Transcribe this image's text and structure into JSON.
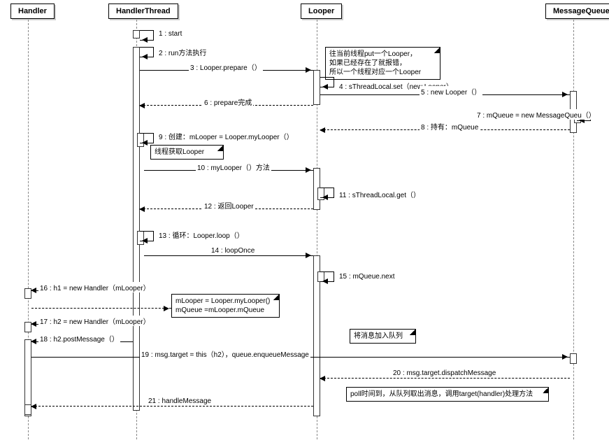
{
  "participants": {
    "handler": "Handler",
    "handlerThread": "HandlerThread",
    "looper": "Looper",
    "messageQueue": "MessageQueue"
  },
  "messages": {
    "m1": "1 : start",
    "m2": "2 : run方法执行",
    "m3": "3 : Looper.prepare（）",
    "m4": "4 : sThreadLocal.set（new Looper）",
    "m5": "5 : new Looper（）",
    "m6": "6 : prepare完成",
    "m7": "7 : mQueue = new MessageQueu（）",
    "m8": "8 : 持有：mQueue",
    "m9": "9 : 创建：mLooper = Looper.myLooper（）",
    "m10": "10 : myLooper（）方法",
    "m11": "11 : sThreadLocal.get（）",
    "m12": "12 : 返回Looper",
    "m13": "13 : 循环：Looper.loop（）",
    "m14": "14 : loopOnce",
    "m15": "15 : mQueue.next",
    "m16": "16 : h1 = new Handler（mLooper）",
    "m17": "17 : h2 = new Handler（mLooper）",
    "m18": "18 : h2.postMessage（）",
    "m19": "19 : msg.target = this（h2），queue.enqueueMessage",
    "m20": "20 : msg.target.dispatchMessage",
    "m21": "21 : handleMessage"
  },
  "notes": {
    "n1": "往当前线程put一个Looper，\n如果已经存在了就报错，\n所以一个线程对应一个Looper",
    "n2": "线程获取Looper",
    "n3": "mLooper = Looper.myLooper()\nmQueue =mLooper.mQueue",
    "n4": "将消息加入队列",
    "n5": "poll时间到，从队列取出消息，调用target(handler)处理方法"
  }
}
